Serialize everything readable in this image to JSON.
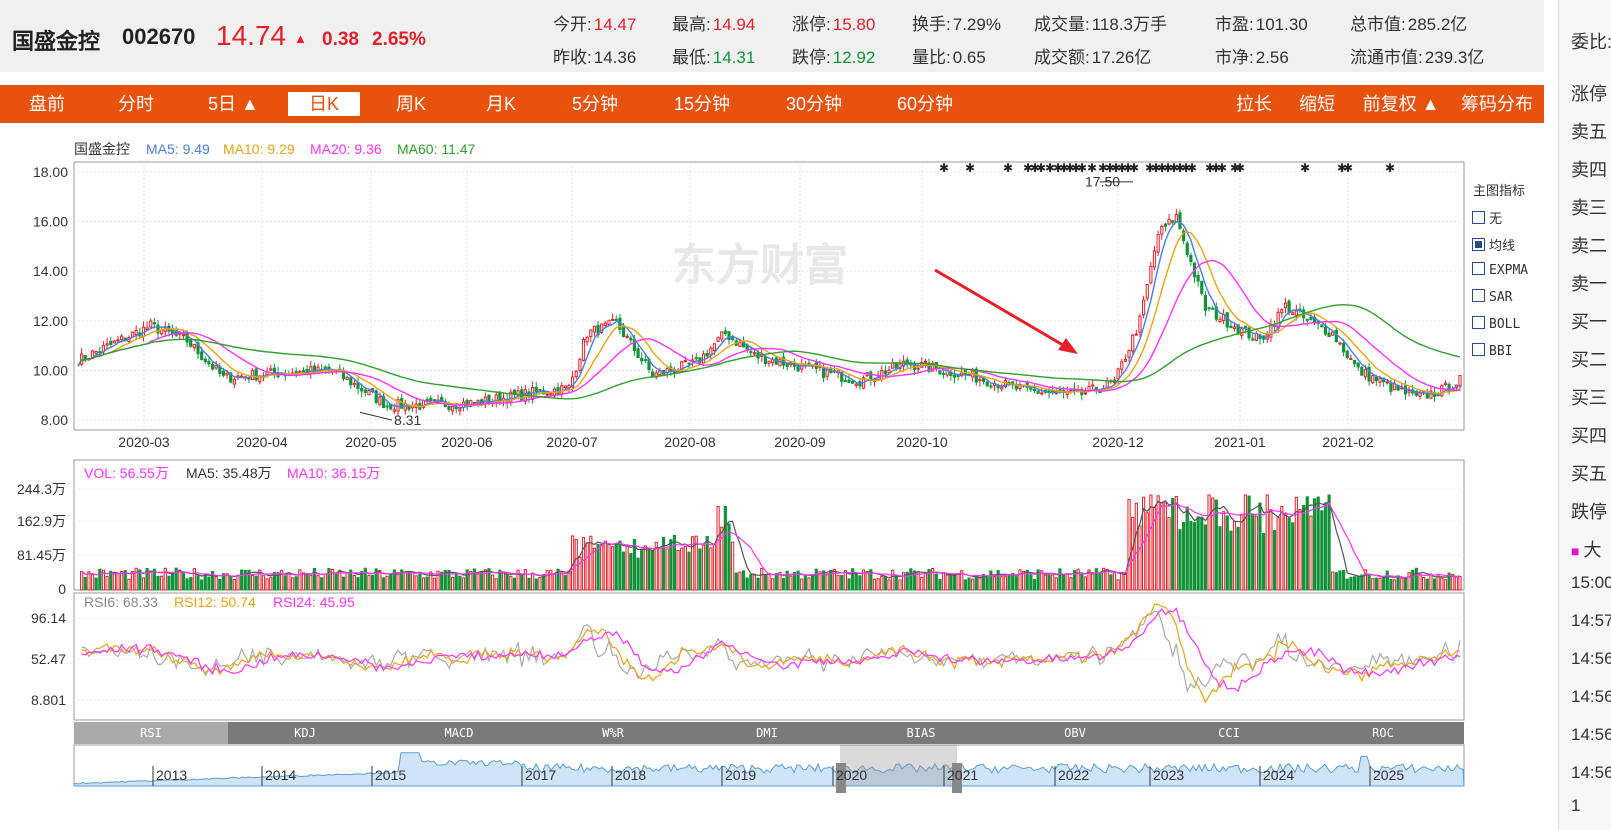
{
  "header": {
    "name": "国盛金控",
    "code": "002670",
    "price": "14.74",
    "change": "0.38",
    "change_pct": "2.65%",
    "quotes_row1": [
      {
        "label": "今开:",
        "value": "14.47",
        "color": "red"
      },
      {
        "label": "最高:",
        "value": "14.94",
        "color": "red"
      },
      {
        "label": "涨停:",
        "value": "15.80",
        "color": "red"
      },
      {
        "label": "换手:",
        "value": "7.29%",
        "color": ""
      },
      {
        "label": "成交量:",
        "value": "118.3万手",
        "color": ""
      },
      {
        "label": "市盈:",
        "value": "101.30",
        "color": ""
      },
      {
        "label": "总市值:",
        "value": "285.2亿",
        "color": ""
      }
    ],
    "quotes_row2": [
      {
        "label": "昨收:",
        "value": "14.36",
        "color": ""
      },
      {
        "label": "最低:",
        "value": "14.31",
        "color": "green"
      },
      {
        "label": "跌停:",
        "value": "12.92",
        "color": "green"
      },
      {
        "label": "量比:",
        "value": "0.65",
        "color": ""
      },
      {
        "label": "成交额:",
        "value": "17.26亿",
        "color": ""
      },
      {
        "label": "市净:",
        "value": "2.56",
        "color": ""
      },
      {
        "label": "流通市值:",
        "value": "239.3亿",
        "color": ""
      }
    ]
  },
  "tabs": [
    "盘前",
    "分时",
    "5日 ▲",
    "日K",
    "周K",
    "月K",
    "5分钟",
    "15分钟",
    "30分钟",
    "60分钟"
  ],
  "tabs_right": [
    "拉长",
    "缩短",
    "前复权 ▲",
    "筹码分布"
  ],
  "right_panel": [
    "委比:",
    "涨停",
    "卖五",
    "卖四",
    "卖三",
    "卖二",
    "卖一",
    "买一",
    "买二",
    "买三",
    "买四",
    "买五",
    "跌停",
    "大",
    "15:00",
    "14:57",
    "14:56",
    "14:56",
    "14:56",
    "14:56",
    "1"
  ],
  "main_chart": {
    "legend_name": "国盛金控",
    "ma5": "MA5: 9.49",
    "ma10": "MA10: 9.29",
    "ma20": "MA20: 9.36",
    "ma60": "MA60: 11.47",
    "y_ticks": [
      "18.00",
      "16.00",
      "14.00",
      "12.00",
      "10.00",
      "8.00"
    ],
    "x_ticks": [
      "2020-03",
      "2020-04",
      "2020-05",
      "2020-06",
      "2020-07",
      "2020-08",
      "2020-09",
      "2020-10",
      "2020-12",
      "2021-01",
      "2021-02"
    ],
    "high_label": "17.50",
    "low_label": "8.31",
    "watermark": "东方财富",
    "indicator_title": "主图指标",
    "indicators": [
      {
        "label": "无",
        "checked": false
      },
      {
        "label": "均线",
        "checked": true
      },
      {
        "label": "EXPMA",
        "checked": false
      },
      {
        "label": "SAR",
        "checked": false
      },
      {
        "label": "BOLL",
        "checked": false
      },
      {
        "label": "BBI",
        "checked": false
      }
    ],
    "colors": {
      "up": "#e4212b",
      "down": "#139339",
      "ma5": "#4a7fdc",
      "ma10": "#e8a317",
      "ma20": "#ff33ff",
      "ma60": "#2ea02e"
    }
  },
  "volume_chart": {
    "vol": "VOL: 56.55万",
    "ma5": "MA5: 35.48万",
    "ma10": "MA10: 36.15万",
    "y_ticks": [
      "244.3万",
      "162.9万",
      "81.45万",
      "0"
    ]
  },
  "rsi_chart": {
    "rsi6": "RSI6: 68.33",
    "rsi12": "RSI12: 50.74",
    "rsi24": "RSI24: 45.95",
    "y_ticks": [
      "96.14",
      "52.47",
      "8.801"
    ]
  },
  "indicator_tabs": [
    "RSI",
    "KDJ",
    "MACD",
    "W%R",
    "DMI",
    "BIAS",
    "OBV",
    "CCI",
    "ROC"
  ],
  "navigator": {
    "years": [
      "2013",
      "2014",
      "2015",
      "2017",
      "2018",
      "2019",
      "2020",
      "2021",
      "2022",
      "2023",
      "2024",
      "2025"
    ]
  }
}
